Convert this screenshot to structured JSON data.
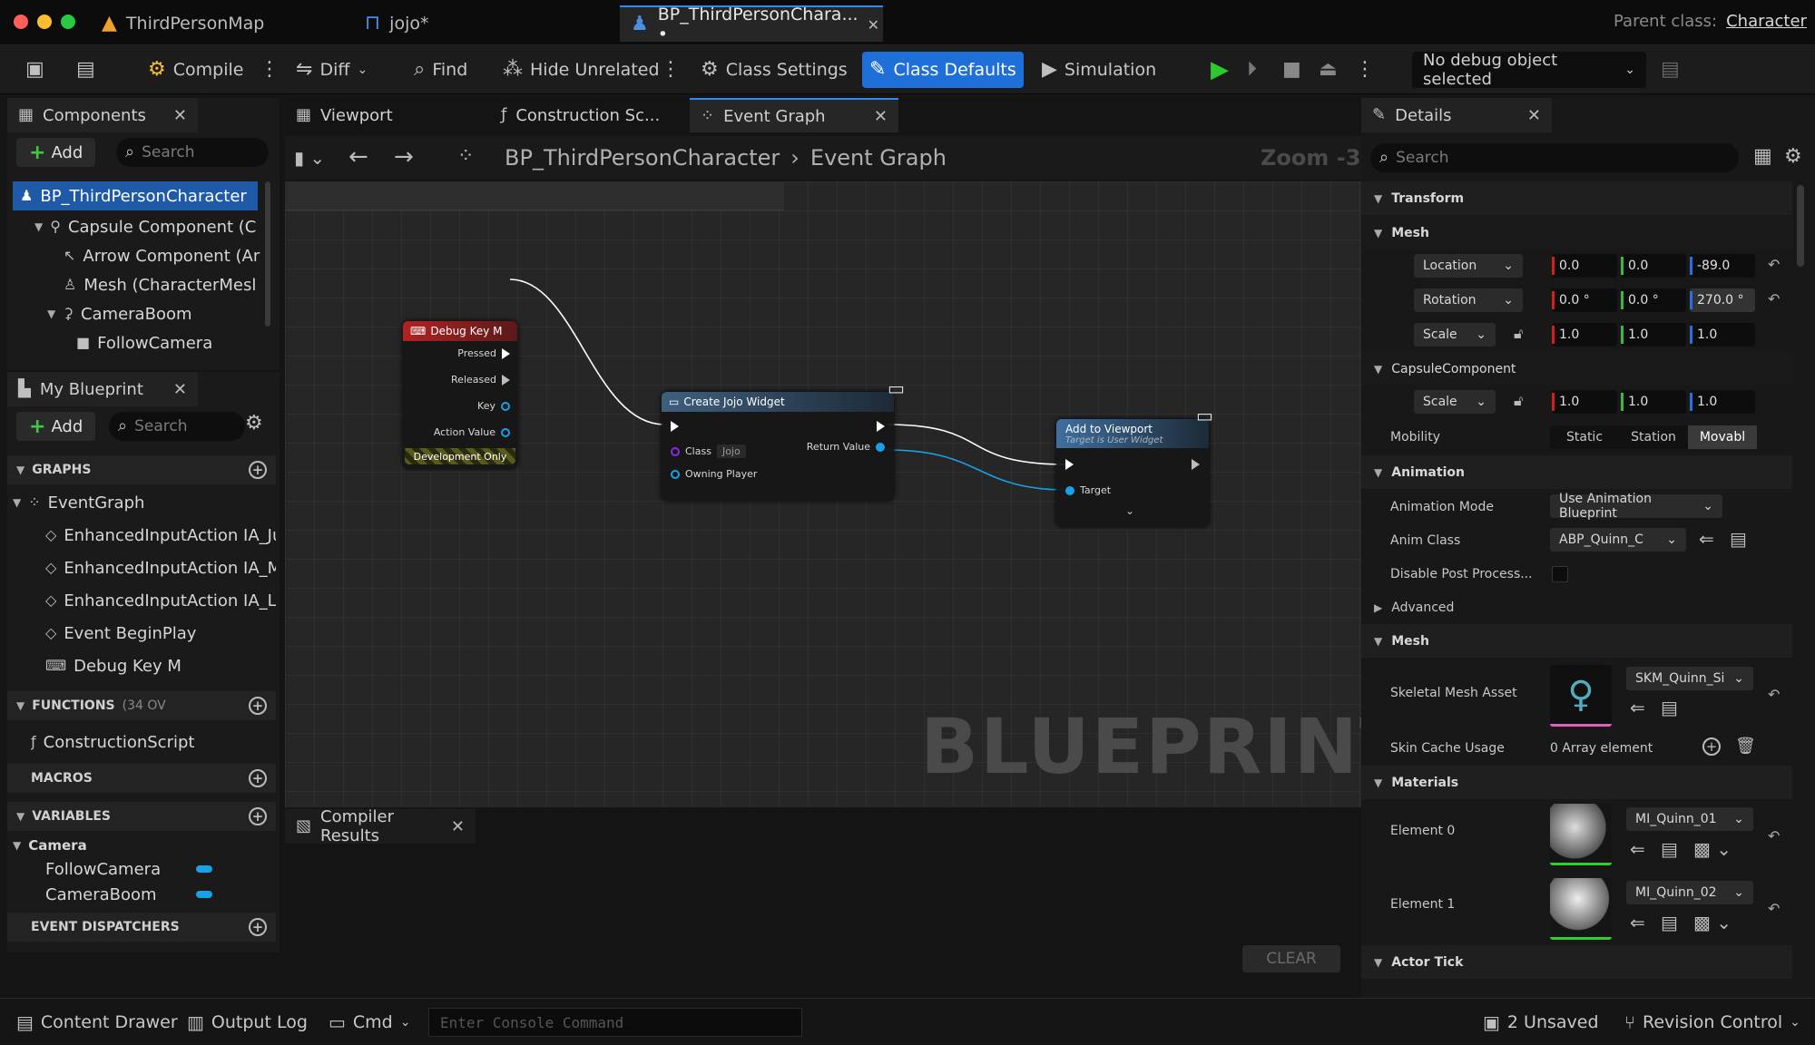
{
  "titlebar": {
    "tabs": [
      {
        "label": "ThirdPersonMap"
      },
      {
        "label": "jojo*"
      },
      {
        "label": "BP_ThirdPersonChara... •"
      }
    ],
    "parent_class_label": "Parent class:",
    "parent_class_value": "Character"
  },
  "toolbar": {
    "compile": "Compile",
    "diff": "Diff",
    "find": "Find",
    "hide_unrelated": "Hide Unrelated",
    "class_settings": "Class Settings",
    "class_defaults": "Class Defaults",
    "simulation": "Simulation",
    "debug_object": "No debug object selected"
  },
  "components": {
    "tab_label": "Components",
    "add_label": "Add",
    "search_placeholder": "Search",
    "tree": [
      "BP_ThirdPersonCharacter",
      "Capsule Component (C",
      "Arrow Component (Ar",
      "Mesh (CharacterMesl",
      "CameraBoom",
      "FollowCamera"
    ]
  },
  "my_blueprint": {
    "tab_label": "My Blueprint",
    "add_label": "Add",
    "search_placeholder": "Search",
    "graphs_label": "GRAPHS",
    "event_graph": "EventGraph",
    "graph_items": [
      "EnhancedInputAction IA_Ju",
      "EnhancedInputAction IA_M",
      "EnhancedInputAction IA_Lc",
      "Event BeginPlay",
      "Debug Key M"
    ],
    "functions_label": "FUNCTIONS",
    "functions_count": "(34 OV",
    "construction_script": "ConstructionScript",
    "macros_label": "MACROS",
    "variables_label": "VARIABLES",
    "var_category": "Camera",
    "variables": [
      "FollowCamera",
      "CameraBoom"
    ],
    "event_dispatchers_label": "EVENT DISPATCHERS"
  },
  "editor_tabs": {
    "viewport": "Viewport",
    "construction": "Construction Sc...",
    "event_graph": "Event Graph"
  },
  "graph": {
    "breadcrumb_root": "BP_ThirdPersonCharacter",
    "breadcrumb_leaf": "Event Graph",
    "zoom": "Zoom -3",
    "watermark": "BLUEPRINT",
    "nodes": {
      "debug_key": {
        "title": "Debug Key M",
        "pins": [
          "Pressed",
          "Released",
          "Key",
          "Action Value"
        ],
        "footer": "Development Only"
      },
      "create_widget": {
        "title": "Create Jojo Widget",
        "class_label": "Class",
        "class_value": "Jojo",
        "return_value": "Return Value",
        "owning_player": "Owning Player"
      },
      "add_to_viewport": {
        "title": "Add to Viewport",
        "subtitle": "Target is User Widget",
        "target": "Target"
      }
    }
  },
  "compiler_results": {
    "tab_label": "Compiler Results",
    "clear_label": "CLEAR"
  },
  "details": {
    "tab_label": "Details",
    "search_placeholder": "Search",
    "transform_hdr": "Transform",
    "mesh_hdr": "Mesh",
    "location_label": "Location",
    "location": [
      "0.0",
      "0.0",
      "-89.0"
    ],
    "rotation_label": "Rotation",
    "rotation": [
      "0.0 °",
      "0.0 °",
      "270.0 °"
    ],
    "scale_label": "Scale",
    "scale": [
      "1.0",
      "1.0",
      "1.0"
    ],
    "capsule_hdr": "CapsuleComponent",
    "capsule_scale_label": "Scale",
    "capsule_scale": [
      "1.0",
      "1.0",
      "1.0"
    ],
    "mobility_label": "Mobility",
    "mobility_options": [
      "Static",
      "Station",
      "Movabl"
    ],
    "animation_hdr": "Animation",
    "anim_mode_label": "Animation Mode",
    "anim_mode_value": "Use Animation Blueprint",
    "anim_class_label": "Anim Class",
    "anim_class_value": "ABP_Quinn_C",
    "disable_post_label": "Disable Post Process...",
    "advanced_label": "Advanced",
    "mesh2_hdr": "Mesh",
    "skeletal_label": "Skeletal Mesh Asset",
    "skeletal_value": "SKM_Quinn_Si",
    "skin_cache_label": "Skin Cache Usage",
    "skin_cache_value": "0 Array element",
    "materials_hdr": "Materials",
    "element0_label": "Element 0",
    "element0_value": "MI_Quinn_01",
    "element1_label": "Element 1",
    "element1_value": "MI_Quinn_02",
    "actor_tick_hdr": "Actor Tick"
  },
  "bottombar": {
    "content_drawer": "Content Drawer",
    "output_log": "Output Log",
    "cmd": "Cmd",
    "console_placeholder": "Enter Console Command",
    "unsaved": "2 Unsaved",
    "revision_control": "Revision Control"
  },
  "colors": {
    "accent": "#1e6fd9",
    "debug_key_header": "#b22222",
    "function_header": "#3f5f7f",
    "object_pin": "#19a0e6",
    "play_green": "#2ec92e"
  }
}
